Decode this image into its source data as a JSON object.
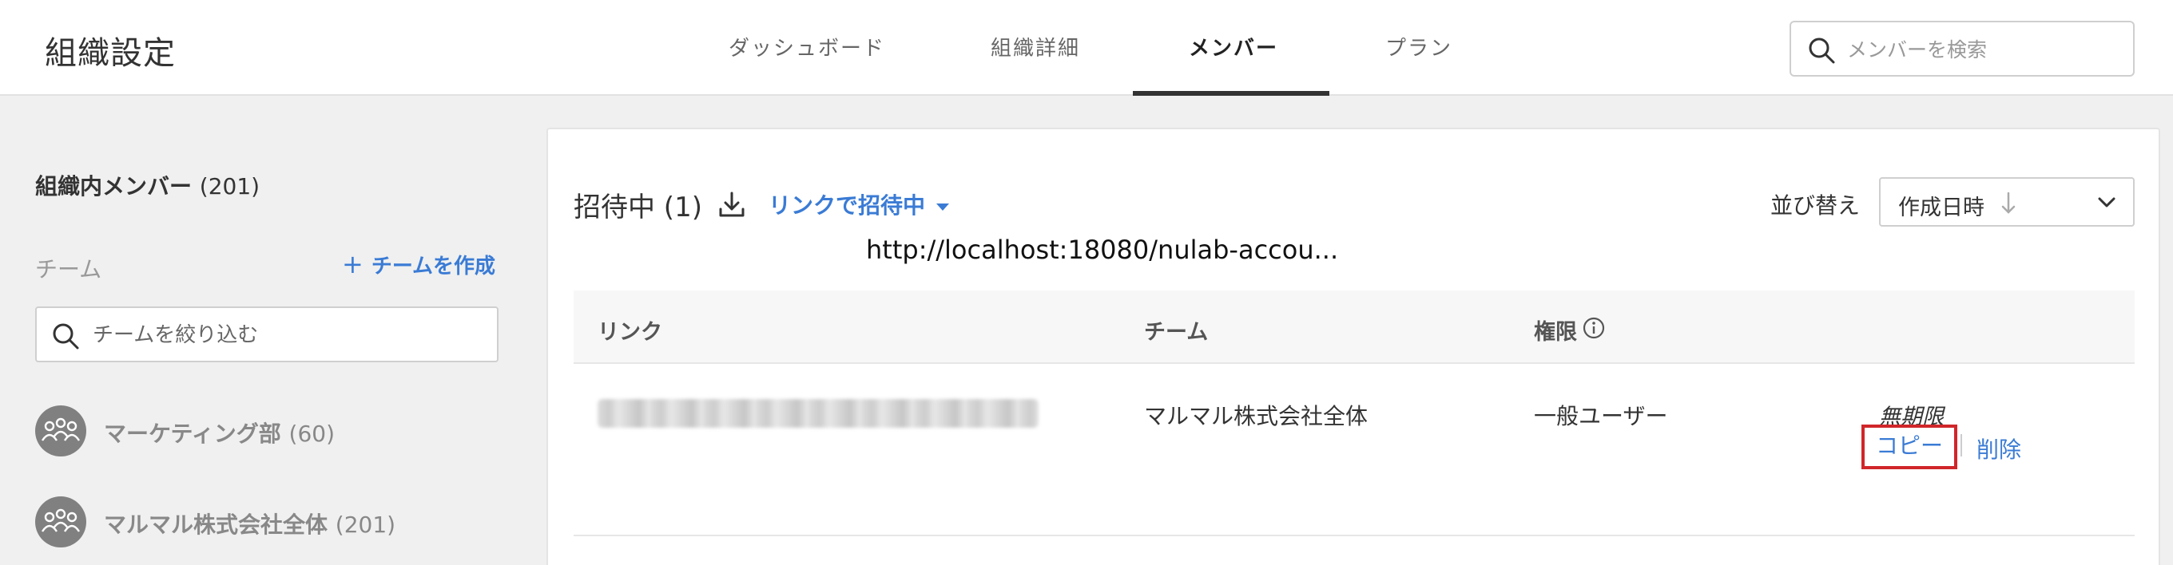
{
  "header": {
    "title": "組織設定",
    "tabs": [
      {
        "label": "ダッシュボード",
        "active": false
      },
      {
        "label": "組織詳細",
        "active": false
      },
      {
        "label": "メンバー",
        "active": true
      },
      {
        "label": "プラン",
        "active": false
      }
    ],
    "search": {
      "placeholder": "メンバーを検索",
      "value": "",
      "icon": "search-icon"
    }
  },
  "sidebar": {
    "title": "組織内メンバー",
    "title_count": "(201)",
    "team_label": "チーム",
    "create_team": "チームを作成",
    "filter": {
      "placeholder": "チームを絞り込む",
      "value": "",
      "icon": "search-icon"
    },
    "teams": [
      {
        "name": "マーケティング部",
        "count": "(60)",
        "icon": "team-icon"
      },
      {
        "name": "マルマル株式会社全体",
        "count": "(201)",
        "icon": "team-icon"
      }
    ]
  },
  "main": {
    "invite_title": "招待中 (1)",
    "invite_dropdown": "リンクで招待中",
    "download_icon": "download-icon",
    "tooltip_url": "http://localhost:18080/nulab-accou...",
    "sort": {
      "label": "並び替え",
      "value": "作成日時",
      "direction": "descending"
    },
    "table": {
      "headers": [
        "リンク",
        "チーム",
        "権限",
        ""
      ],
      "rows": [
        {
          "link": "",
          "team": "マルマル株式会社全体",
          "role": "一般ユーザー",
          "expire": "無期限",
          "copy": "コピー",
          "delete": "削除"
        }
      ]
    }
  },
  "colors": {
    "accent": "#3a7bd5",
    "highlight": "#d0262a",
    "background": "#f0f0f0"
  }
}
